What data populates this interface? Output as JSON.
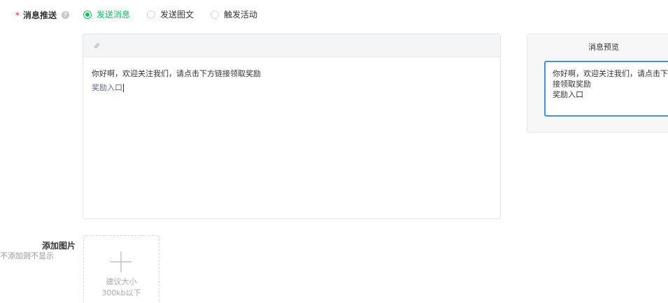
{
  "form": {
    "push": {
      "required_mark": "*",
      "label": "消息推送",
      "help_icon": "question-circle-icon",
      "options": [
        {
          "label": "发送消息",
          "checked": true
        },
        {
          "label": "发送图文",
          "checked": false
        },
        {
          "label": "触发活动",
          "checked": false
        }
      ]
    },
    "editor": {
      "toolbar_icon": "link-icon",
      "line1": "你好啊，欢迎关注我们，请点击下方链接领取奖励",
      "link_text": "奖励入口"
    },
    "preview": {
      "title": "消息预览",
      "lines": [
        "你好啊，欢迎关注我们，请点击下方链",
        "接领取奖励",
        "奖励入口"
      ]
    },
    "add_image": {
      "label": "添加图片",
      "sublabel": "不添加则不显示",
      "hint_line1": "建议大小",
      "hint_line2": "300kb以下"
    }
  },
  "colors": {
    "accent": "#07c160",
    "link": "#576b95",
    "preview_border": "#4a90d9",
    "required": "#f5222d"
  }
}
